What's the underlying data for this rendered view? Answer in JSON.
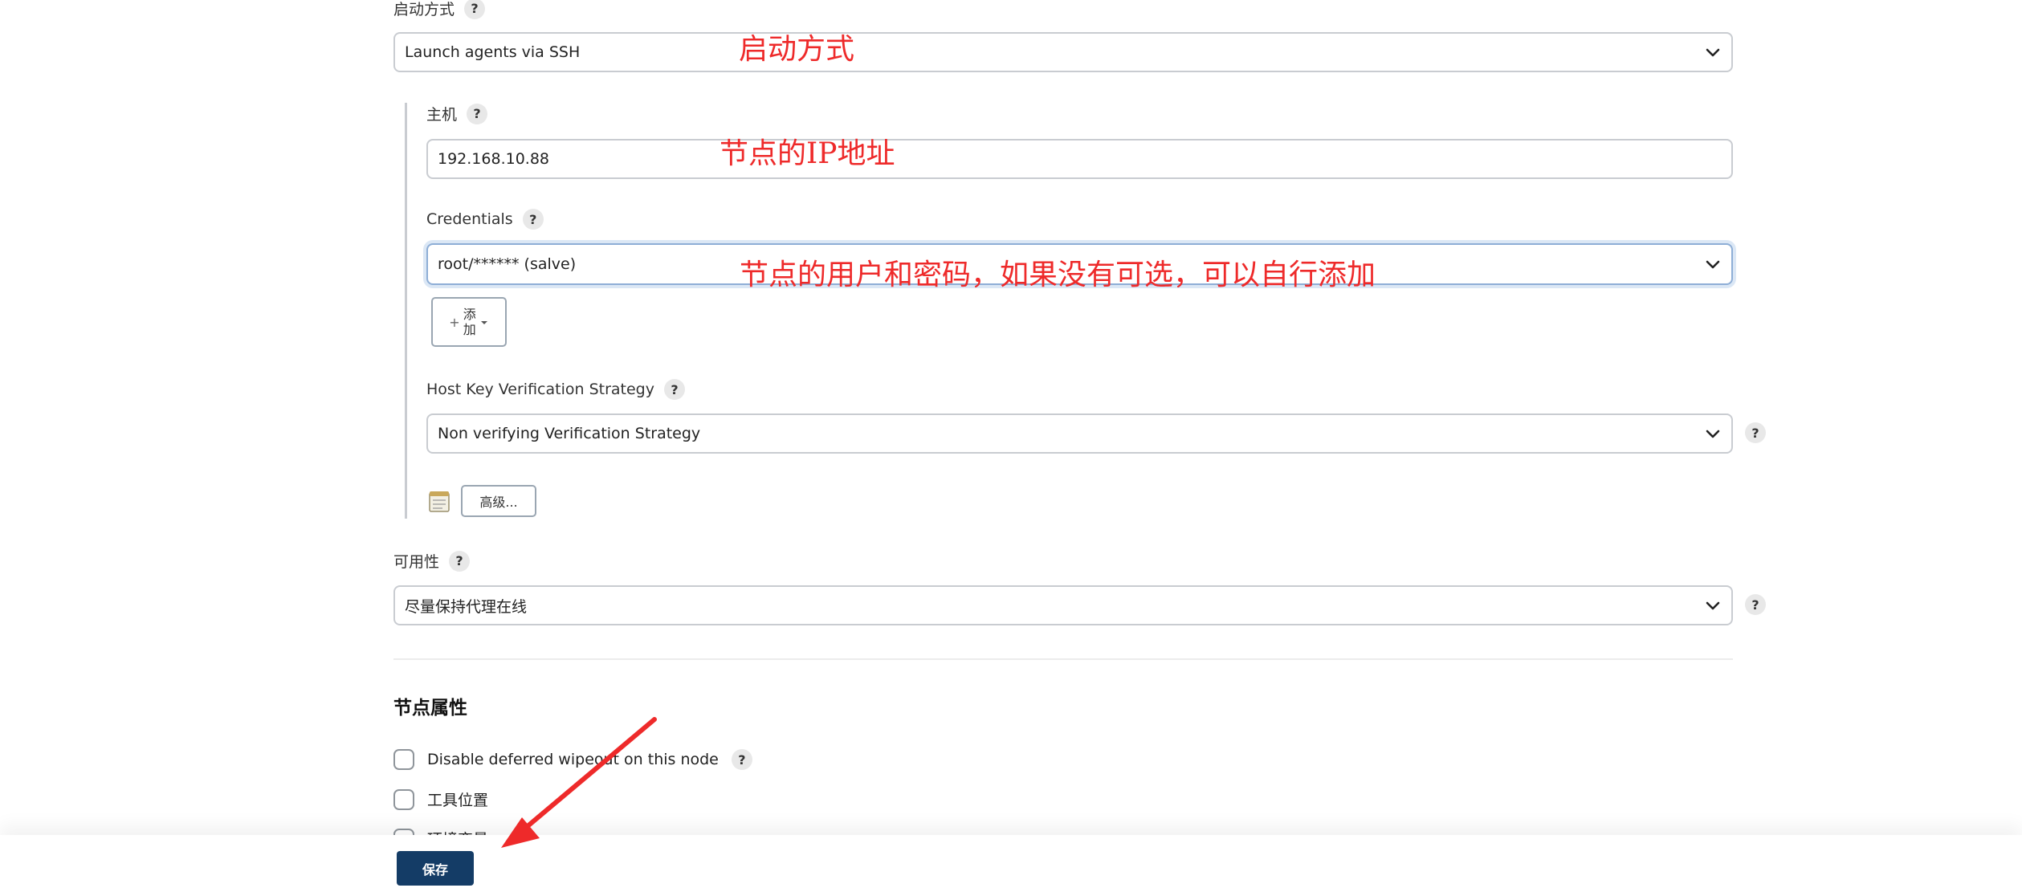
{
  "launch": {
    "label": "启动方式",
    "value": "Launch agents via SSH",
    "annotation": "启动方式"
  },
  "host": {
    "label": "主机",
    "value": "192.168.10.88",
    "annotation": "节点的IP地址"
  },
  "credentials": {
    "label": "Credentials",
    "value": "root/****** (salve)",
    "annotation": "节点的用户和密码，如果没有可选，可以自行添加",
    "add_button_line1": "添",
    "add_button_line2": "加",
    "add_plus": "+"
  },
  "host_key": {
    "label": "Host Key Verification Strategy",
    "value": "Non verifying Verification Strategy"
  },
  "advanced": {
    "button_label": "高级..."
  },
  "availability": {
    "label": "可用性",
    "value": "尽量保持代理在线"
  },
  "node_properties": {
    "title": "节点属性",
    "items": [
      {
        "label": "Disable deferred wipeout on this node",
        "checked": false
      },
      {
        "label": "工具位置",
        "checked": false
      },
      {
        "label": "环境变量",
        "checked": false
      }
    ]
  },
  "help_glyph": "?",
  "footer": {
    "save_label": "保存"
  },
  "colors": {
    "annotation_red": "#ee2a2a",
    "save_button": "#143c66",
    "focus_border": "#8eaed6"
  }
}
